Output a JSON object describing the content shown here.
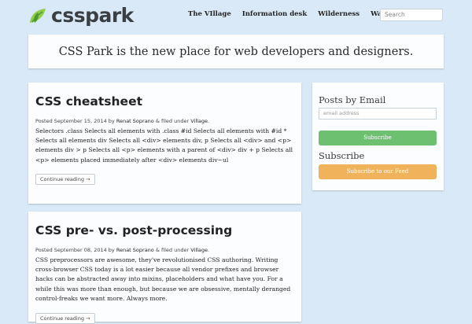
{
  "brand": {
    "name": "csspark",
    "logo_icon": "leaf-icon",
    "colors": {
      "leaf_dark": "#4f9a2e",
      "leaf_light": "#8fcf4a",
      "text": "#3a3f44"
    }
  },
  "nav": {
    "items": [
      "The VIllage",
      "Information desk",
      "Wilderness",
      "Wall of fame"
    ]
  },
  "search": {
    "placeholder": "Search"
  },
  "hero": {
    "text": "CSS Park is the new place for web developers and designers."
  },
  "posts": [
    {
      "title": "CSS cheatsheet",
      "meta_prefix": "Posted September 15, 2014 by",
      "author": "Renat Soprano",
      "meta_mid": "& filed under",
      "category": "Village",
      "meta_end": ".",
      "body": "Selectors .class Selects all elements with .class #id Selects all elements with #id * Selects all elements div Selects all <div> elements div, p Selects all <div> and <p> elements div > p Selects all <p> elements with a parent of <div> div + p Selects all <p> elements placed immediately after <div> elements div~ul",
      "continue_label": "Continue reading →"
    },
    {
      "title": "CSS pre- vs. post-processing",
      "meta_prefix": "Posted September 08, 2014 by",
      "author": "Renat Soprano",
      "meta_mid": "& filed under",
      "category": "Village",
      "meta_end": ".",
      "body": "CSS preprocessors are awesome, they've revolutionised CSS authoring. Writing cross-browser CSS today is a lot easier because all vendor prefixes and browser hacks can be abstracted away into mixins, placeholders and what have you. For a while this was more than enough, but because we are obsessive, mentally deranged control-freaks we want more. Always more.",
      "continue_label": "Continue reading →"
    }
  ],
  "sidebar": {
    "email_heading": "Posts by Email",
    "email_placeholder": "email address",
    "subscribe_button": "Subscribe",
    "subscribe_heading": "Subscribe",
    "feed_button": "Subscribe to our Feed",
    "colors": {
      "subscribe": "#6cc070",
      "feed": "#f0b35c"
    }
  },
  "colors": {
    "background": "#d9e9f7",
    "card": "#fbfdff"
  }
}
